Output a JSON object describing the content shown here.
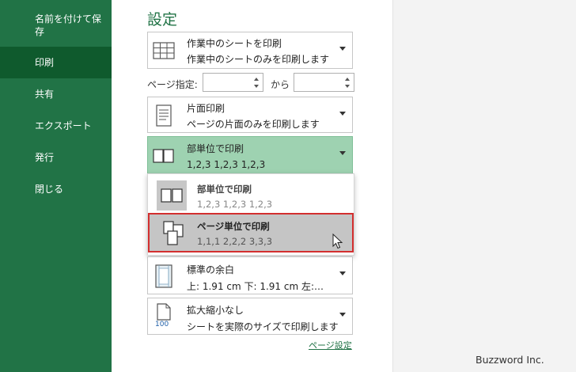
{
  "sidebar": {
    "items": [
      {
        "label": "名前を付けて保存",
        "label_line1": "名前を付けて保",
        "label_line2": "存"
      },
      {
        "label": "印刷",
        "active": true
      },
      {
        "label": "共有"
      },
      {
        "label": "エクスポート"
      },
      {
        "label": "発行"
      },
      {
        "label": "閉じる"
      }
    ]
  },
  "settings": {
    "title": "設定",
    "print_what": {
      "title": "作業中のシートを印刷",
      "subtitle": "作業中のシートのみを印刷します",
      "icon": "sheet-grid-icon"
    },
    "pages": {
      "label": "ページ指定:",
      "from_value": "",
      "to_label": "から",
      "to_value": ""
    },
    "sides": {
      "title": "片面印刷",
      "subtitle": "ページの片面のみを印刷します",
      "icon": "one-sided-page-icon"
    },
    "collation": {
      "title": "部単位で印刷",
      "subtitle": "1,2,3    1,2,3    1,2,3",
      "icon": "collated-icon"
    },
    "collation_options": [
      {
        "title": "部単位で印刷",
        "subtitle": "1,2,3    1,2,3    1,2,3",
        "icon": "collated-icon"
      },
      {
        "title": "ページ単位で印刷",
        "subtitle": "1,1,1    2,2,2    3,3,3",
        "icon": "uncollated-icon",
        "selected": true
      }
    ],
    "margins": {
      "title": "標準の余白",
      "subtitle": "上: 1.91 cm 下: 1.91 cm 左:…",
      "icon": "margins-icon"
    },
    "scaling": {
      "title": "拡大縮小なし",
      "subtitle": "シートを実際のサイズで印刷します",
      "icon": "actual-size-icon",
      "icon_text": "100"
    },
    "page_setup_link": "ページ設定"
  },
  "watermark": "Buzzword Inc.",
  "colors": {
    "accent": "#217346",
    "nav_active": "#0f5a2d",
    "collation_bg": "#9ed2b1",
    "selected_bg": "#c5c5c5",
    "highlight_border": "#d32f2f"
  }
}
